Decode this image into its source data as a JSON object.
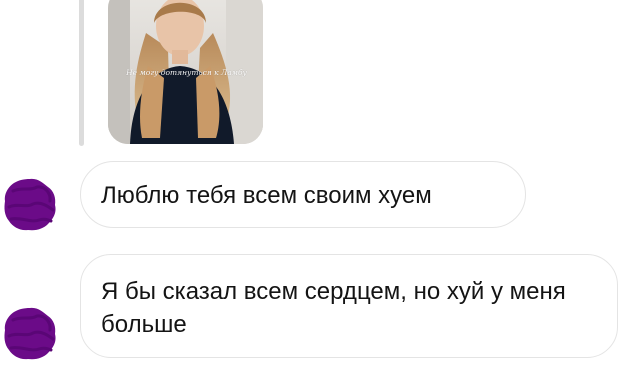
{
  "story": {
    "caption": "Не могу дотянуться к Ламбу"
  },
  "messages": [
    {
      "text": "Люблю тебя всем своим хуем"
    },
    {
      "text": "Я бы сказал всем сердцем, но хуй у меня больше"
    }
  ],
  "colors": {
    "avatar_censor": "#6b0b88",
    "bubble_border": "#e4e4e4",
    "reply_line": "#dcdcdc",
    "text": "#141414"
  },
  "icons": {
    "avatar": "censored-avatar"
  }
}
